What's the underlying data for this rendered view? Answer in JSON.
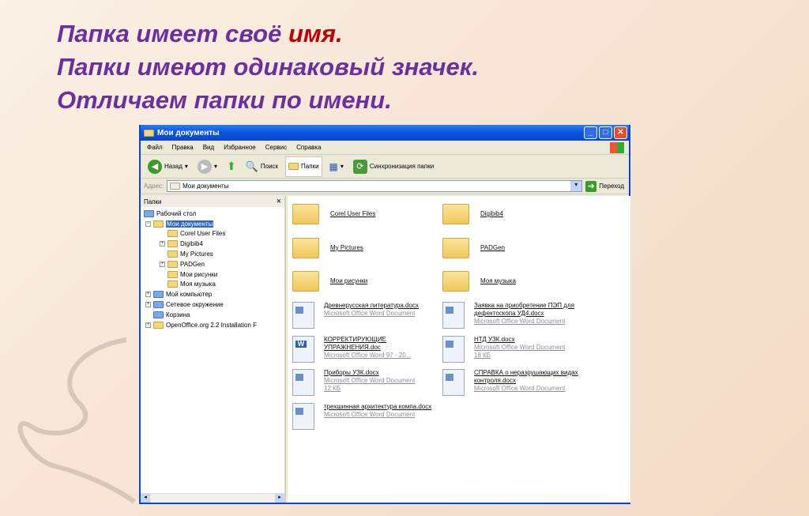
{
  "slide": {
    "line1_a": "Папка имеет своё ",
    "line1_b": "имя.",
    "line2": "Папки имеют одинаковый значек.",
    "line3": "Отличаем папки по имени."
  },
  "window": {
    "title": "Мои документы",
    "menu": [
      "Файл",
      "Правка",
      "Вид",
      "Избранное",
      "Сервис",
      "Справка"
    ],
    "toolbar": {
      "back": "Назад",
      "search": "Поиск",
      "folders": "Папки",
      "sync": "Синхронизация папки"
    },
    "address_label": "Адрес:",
    "address_value": "Мои документы",
    "go_label": "Переход"
  },
  "folders_pane": {
    "title": "Папки",
    "close": "×",
    "tree": [
      {
        "label": "Рабочий стол",
        "level": 0,
        "pm": ""
      },
      {
        "label": "Мои документы",
        "level": 1,
        "pm": "−",
        "selected": true
      },
      {
        "label": "Corel User Files",
        "level": 2,
        "pm": ""
      },
      {
        "label": "Digibib4",
        "level": 2,
        "pm": "+"
      },
      {
        "label": "My Pictures",
        "level": 2,
        "pm": ""
      },
      {
        "label": "PADGen",
        "level": 2,
        "pm": "+"
      },
      {
        "label": "Мои рисунки",
        "level": 2,
        "pm": ""
      },
      {
        "label": "Моя музыка",
        "level": 2,
        "pm": ""
      },
      {
        "label": "Мой компьютер",
        "level": 1,
        "pm": "+"
      },
      {
        "label": "Сетевое окружение",
        "level": 1,
        "pm": "+"
      },
      {
        "label": "Корзина",
        "level": 1,
        "pm": ""
      },
      {
        "label": "OpenOffice.org 2.2 Installation F",
        "level": 1,
        "pm": "+"
      }
    ]
  },
  "content": {
    "folders": [
      "Corel User Files",
      "Digibib4",
      "My Pictures",
      "PADGen",
      "Мои рисунки",
      "Моя музыка"
    ],
    "files": [
      {
        "name": "Древнерусская литература.docx",
        "type": "Microsoft Office Word Document",
        "size": ""
      },
      {
        "name": "Заявка на приобретение ПЭП для дефектоскопа УД4.docx",
        "type": "Microsoft Office Word Document",
        "size": ""
      },
      {
        "name": "КОРРЕКТИРУЮЩИЕ УПРАЖНЕНИЯ.doc",
        "type": "Microsoft Office Word 97 - 20...",
        "size": "",
        "word": true
      },
      {
        "name": "НТД УЗК.docx",
        "type": "Microsoft Office Word Document",
        "size": "18 КБ"
      },
      {
        "name": "Приборы УЗК.docx",
        "type": "Microsoft Office Word Document",
        "size": "12 КБ"
      },
      {
        "name": "СПРАВКА о неразрушающих видах контроля.docx",
        "type": "Microsoft Office Word Document",
        "size": ""
      },
      {
        "name": "трехшинная архитектура компа.docx",
        "type": "Microsoft Office Word Document",
        "size": ""
      }
    ]
  }
}
